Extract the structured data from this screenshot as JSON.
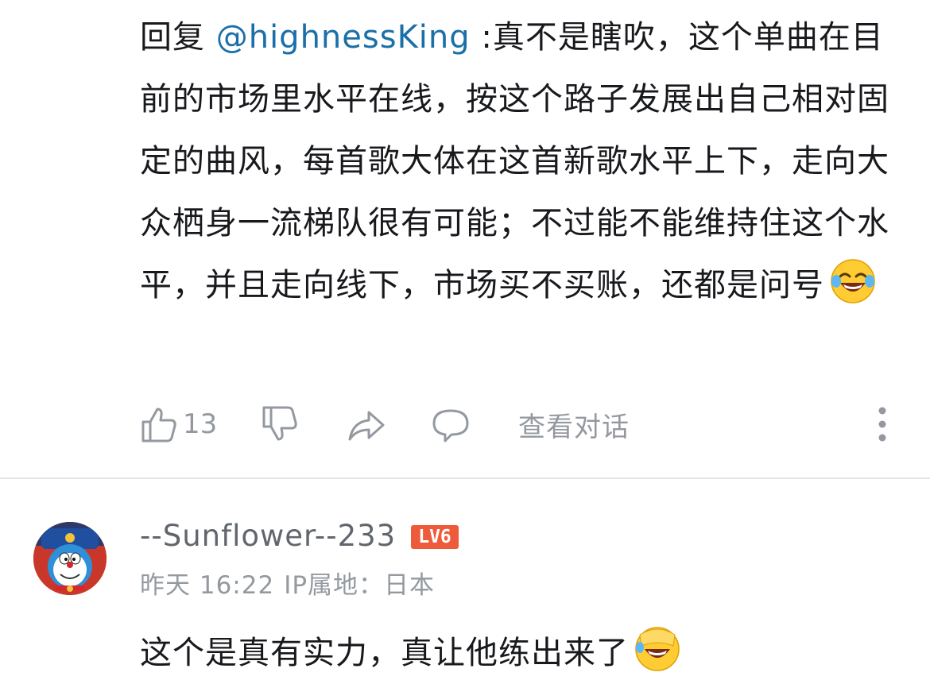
{
  "reply": {
    "prefix": "回复 ",
    "mention": "@highnessKing",
    "text": " :真不是瞎吹，这个单曲在目前的市场里水平在线，按这个路子发展出自己相对固定的曲风，每首歌大体在这首新歌水平上下，走向大众栖身一流梯队很有可能；不过能不能维持住这个水平，并且走向线下，市场买不买账，还都是问号",
    "emoji": "laughing-with-tears-emoji",
    "actions": {
      "like_count": "13",
      "view_conversation": "查看对话"
    }
  },
  "comment": {
    "username": "--Sunflower--233",
    "level": "LV6",
    "date": "昨天 16:22",
    "ip_label": "IP属地：日本",
    "text": "这个是真有实力，真让他练出来了",
    "emoji": "face-covering-laugh-emoji"
  },
  "colors": {
    "mention": "#1b6fa8",
    "muted": "#9499a0",
    "level_badge": "#ee5b3b",
    "text": "#18191c"
  }
}
